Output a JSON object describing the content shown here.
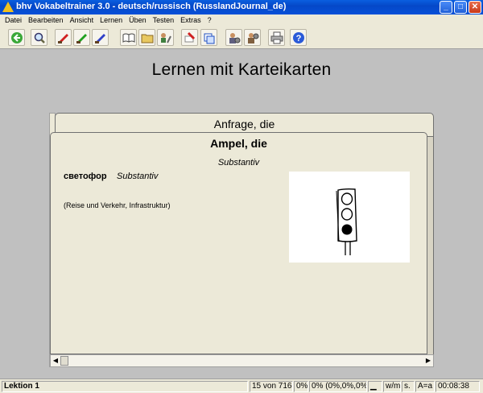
{
  "window": {
    "title": "bhv Vokabeltrainer 3.0 - deutsch/russisch (RusslandJournal_de)",
    "controls": {
      "minimize": "_",
      "maximize": "□",
      "close": "✕"
    }
  },
  "menu": [
    "Datei",
    "Bearbeiten",
    "Ansicht",
    "Lernen",
    "Üben",
    "Testen",
    "Extras",
    "?"
  ],
  "toolbar": {
    "buttons": [
      {
        "icon": "back-arrow-icon"
      },
      {
        "icon": "magnifier-icon"
      },
      {
        "icon": "red-brush-icon"
      },
      {
        "icon": "green-brush-icon"
      },
      {
        "icon": "blue-brush-icon"
      },
      {
        "icon": "open-book-icon"
      },
      {
        "icon": "folder-icon"
      },
      {
        "icon": "people-tools-icon"
      },
      {
        "icon": "red-eraser-icon"
      },
      {
        "icon": "blue-cards-icon"
      },
      {
        "icon": "person-settings-icon"
      },
      {
        "icon": "person-settings-2-icon"
      },
      {
        "icon": "printer-icon"
      },
      {
        "icon": "help-icon"
      }
    ]
  },
  "main": {
    "title": "Lernen mit Karteikarten",
    "card_back": {
      "word": "Anfrage, die"
    },
    "card_front": {
      "word": "Ampel, die",
      "part_of_speech": "Substantiv",
      "translation": "светофор",
      "translation_pos": "Substantiv",
      "category": "(Reise und Verkehr, Infrastruktur)",
      "picture": "traffic-light-drawing"
    }
  },
  "statusbar": {
    "lesson": "Lektion 1",
    "position": "15 von 716",
    "percent1": "0%",
    "percent2": "0% (0%,0%,0%)",
    "mode": "w/m",
    "s": "s.",
    "case": "A=a",
    "timer": "00:08:38"
  },
  "colors": {
    "titlebar": "#0548c8",
    "panel": "#ece9d8",
    "background": "#c0c0c0"
  }
}
